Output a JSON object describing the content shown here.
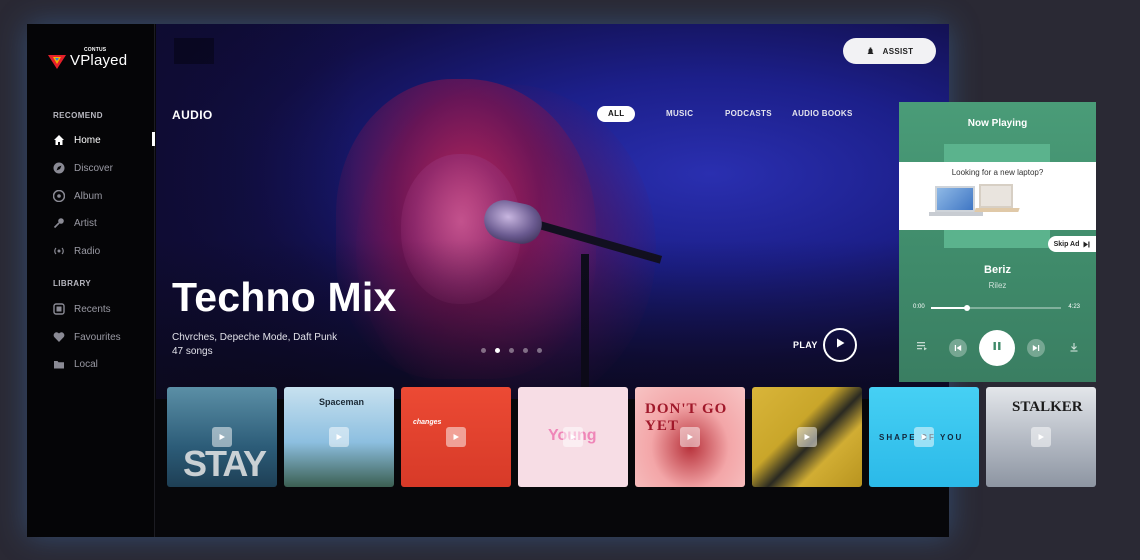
{
  "app": {
    "brand_small": "CONTUS",
    "brand": "VPlayed"
  },
  "sidebar": {
    "sections": [
      {
        "label": "RECOMEND",
        "items": [
          {
            "label": "Home",
            "icon": "home-icon",
            "active": true
          },
          {
            "label": "Discover",
            "icon": "compass-icon"
          },
          {
            "label": "Album",
            "icon": "album-icon"
          },
          {
            "label": "Artist",
            "icon": "microphone-icon"
          },
          {
            "label": "Radio",
            "icon": "radio-icon"
          }
        ]
      },
      {
        "label": "LIBRARY",
        "items": [
          {
            "label": "Recents",
            "icon": "recents-icon"
          },
          {
            "label": "Favourites",
            "icon": "heart-icon"
          },
          {
            "label": "Local",
            "icon": "folder-icon"
          }
        ]
      }
    ]
  },
  "header": {
    "assist_label": "ASSIST",
    "section_title": "AUDIO",
    "tabs": [
      {
        "label": "ALL",
        "active": true
      },
      {
        "label": "MUSIC"
      },
      {
        "label": "PODCASTS"
      },
      {
        "label": "AUDIO BOOKS"
      }
    ]
  },
  "hero": {
    "title": "Techno Mix",
    "artists": "Chvrches, Depeche Mode, Daft Punk",
    "count": "47 songs",
    "play_label": "PLAY",
    "slides": 5,
    "active_slide": 1
  },
  "albums": [
    {
      "art_text": "STAY",
      "color": "#3a6f8e"
    },
    {
      "art_text": "Spaceman",
      "color": "#7fb3d6"
    },
    {
      "art_text": "changes",
      "color": "#e5412f"
    },
    {
      "art_text": "Young",
      "color": "#f6d7e0"
    },
    {
      "art_text": "DON'T GO YET",
      "color": "#f3a6a8"
    },
    {
      "art_text": "",
      "color": "#c9a62a"
    },
    {
      "art_text": "SHAPE OF YOU",
      "color": "#3cc9ef"
    },
    {
      "art_text": "STALKER",
      "color": "#b9bec8"
    }
  ],
  "now_playing": {
    "title": "Now Playing",
    "ad_text": "Looking for a new laptop?",
    "skip_ad": "Skip Ad",
    "song": "Beriz",
    "artist": "Rilez",
    "time_current": "0:00",
    "time_total": "4:23",
    "progress": 0.28
  },
  "colors": {
    "accent": "#ffffff",
    "now_playing_bg": "#4a9c78",
    "brand_red": "#e5202a"
  }
}
